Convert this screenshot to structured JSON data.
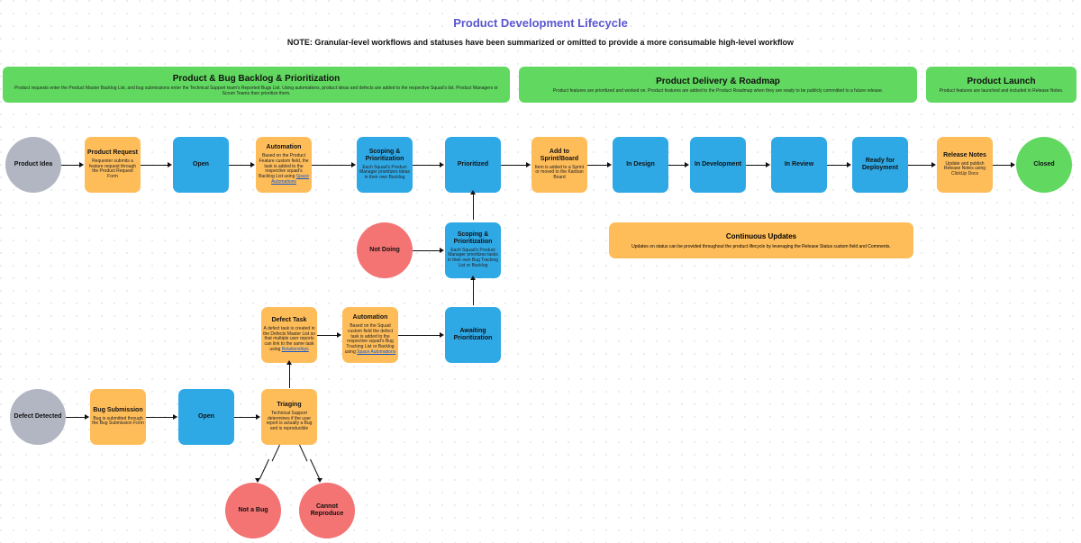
{
  "title": "Product Development Lifecycle",
  "subtitle": "NOTE: Granular-level workflows and statuses have been summarized or omitted to provide a more consumable high-level workflow",
  "phases": {
    "backlog": {
      "title": "Product & Bug Backlog & Prioritization",
      "desc": "Product requests enter the Product Master Backlog List, and bug submissions enter the Technical Support team's Reported Bugs List. Using automations, product ideas and defects are added to the respective Squad's list. Product Managers or Scrum Teams then prioritize them."
    },
    "delivery": {
      "title": "Product Delivery & Roadmap",
      "desc": "Product features are prioritized and worked on. Product features are added to the Product Roadmap when they are ready to be publicly committed to a future release."
    },
    "launch": {
      "title": "Product Launch",
      "desc": "Product features are launched and included in Release Notes."
    }
  },
  "row1": {
    "idea": {
      "title": "Product Idea"
    },
    "request": {
      "title": "Product Request",
      "desc": "Requester submits a feature request through the Product Request Form"
    },
    "open1": {
      "title": "Open"
    },
    "auto1": {
      "title": "Automation",
      "desc": "Based on the Product Feature custom field, the task is added to the respective squad's Backlog List using ",
      "link": "Space Automations"
    },
    "scope1": {
      "title": "Scoping & Prioritization",
      "desc": "Each Squad's Product Manager prioritizes ideas in their own Backlog"
    },
    "prioritized": {
      "title": "Prioritized"
    },
    "sprint": {
      "title": "Add to Sprint/Board",
      "desc": "Item is added to a Sprint or moved to the Kanban Board"
    },
    "design": {
      "title": "In Design"
    },
    "dev": {
      "title": "In Development"
    },
    "review": {
      "title": "In Review"
    },
    "ready": {
      "title": "Ready for Deployment"
    },
    "release": {
      "title": "Release Notes",
      "desc": "Update and publish Release Notes using ClickUp Docs"
    },
    "closed": {
      "title": "Closed"
    }
  },
  "mid": {
    "notdoing": {
      "title": "Not Doing"
    },
    "scope2": {
      "title": "Scoping & Prioritization",
      "desc": "Each Squad's Product Manager prioritizes tasks in their own Bug Tracking List or Backlog"
    },
    "continuous": {
      "title": "Continuous Updates",
      "desc": "Updates on status can be provided throughout the product lifecycle by leveraging the Release Status custom field and Comments."
    }
  },
  "row2": {
    "defecttask": {
      "title": "Defect Task",
      "desc": "A defect task is created in the Defects Master List so that multiple user reports can link to the same task using ",
      "link": "Relationships"
    },
    "auto2": {
      "title": "Automation",
      "desc": "Based on the Squad custom field the defect task is added to the respective squad's Bug Tracking List or Backlog using ",
      "link": "Space Automations"
    },
    "await": {
      "title": "Awaiting Prioritization"
    }
  },
  "row3": {
    "defect": {
      "title": "Defect Detected"
    },
    "bugsub": {
      "title": "Bug Submission",
      "desc": "Bug is submitted through the Bug Submission Form"
    },
    "open2": {
      "title": "Open"
    },
    "triage": {
      "title": "Triaging",
      "desc": "Technical Support determines if the user report is actually a Bug and is reproducible"
    },
    "notbug": {
      "title": "Not a Bug"
    },
    "cannot": {
      "title": "Cannot Reproduce"
    }
  }
}
